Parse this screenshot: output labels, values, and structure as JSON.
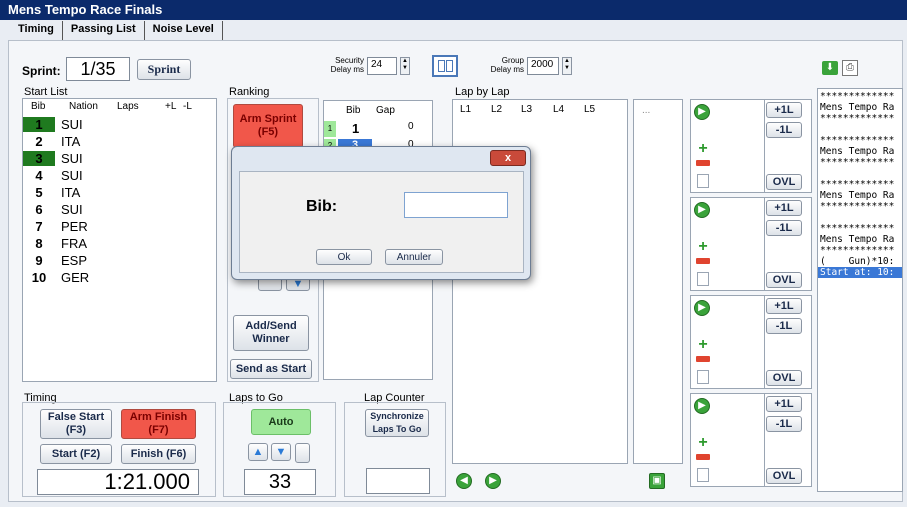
{
  "app": {
    "title": "Mens Tempo Race Finals"
  },
  "tabs": [
    "Timing",
    "Passing List",
    "Noise Level"
  ],
  "sprint": {
    "label": "Sprint:",
    "value": "1/35",
    "button": "Sprint"
  },
  "security": {
    "label1": "Security",
    "label2": "Delay ms",
    "value": "24"
  },
  "group": {
    "label1": "Group",
    "label2": "Delay ms",
    "value": "2000"
  },
  "start_list": {
    "title": "Start List",
    "headers": [
      "Bib",
      "Nation",
      "Laps",
      "+L",
      "-L"
    ],
    "rows": [
      {
        "bib": "1",
        "nation": "SUI",
        "green": true
      },
      {
        "bib": "2",
        "nation": "ITA",
        "green": false
      },
      {
        "bib": "3",
        "nation": "SUI",
        "green": true
      },
      {
        "bib": "4",
        "nation": "SUI",
        "green": false
      },
      {
        "bib": "5",
        "nation": "ITA",
        "green": false
      },
      {
        "bib": "6",
        "nation": "SUI",
        "green": false
      },
      {
        "bib": "7",
        "nation": "PER",
        "green": false
      },
      {
        "bib": "8",
        "nation": "FRA",
        "green": false
      },
      {
        "bib": "9",
        "nation": "ESP",
        "green": false
      },
      {
        "bib": "10",
        "nation": "GER",
        "green": false
      }
    ]
  },
  "ranking": {
    "title": "Ranking",
    "arm_sprint": "Arm Sprint\n(F5)",
    "add_send": "Add/Send\nWinner",
    "send_as_start": "Send as Start",
    "headers": [
      "Bib",
      "Gap"
    ],
    "rows": [
      {
        "pos": "1",
        "bib": "1",
        "gap": "0"
      },
      {
        "pos": "2",
        "bib": "3",
        "gap": "0"
      }
    ]
  },
  "lap_by_lap": {
    "title": "Lap by Lap",
    "headers": [
      "L1",
      "L2",
      "L3",
      "L4",
      "L5"
    ],
    "more": "..."
  },
  "lap_controls": {
    "plus1": "+1L",
    "minus1": "-1L",
    "ovl": "OVL"
  },
  "log": {
    "lines": [
      "*************",
      "Mens Tempo Ra",
      "*************",
      "",
      "*************",
      "Mens Tempo Ra",
      "*************",
      "",
      "*************",
      "Mens Tempo Ra",
      "*************",
      "",
      "*************",
      "Mens Tempo Ra",
      "*************",
      "(    Gun)*10:"
    ],
    "selected": "Start at: 10:"
  },
  "timing": {
    "title": "Timing",
    "false_start": "False Start\n(F3)",
    "arm_finish": "Arm Finish\n(F7)",
    "start": "Start (F2)",
    "finish": "Finish (F6)",
    "time": "1:21.000"
  },
  "laps_to_go": {
    "title": "Laps to Go",
    "auto": "Auto",
    "value": "33"
  },
  "lap_counter": {
    "title": "Lap Counter",
    "sync": "Synchronize\nLaps To Go"
  },
  "dialog": {
    "label": "Bib:",
    "ok": "Ok",
    "cancel": "Annuler",
    "close": "x",
    "input": ""
  },
  "colors": {
    "title_bg": "#0b2a6b",
    "red": "#f1574a",
    "green": "#9fe89a",
    "selection": "#3a78d6"
  }
}
